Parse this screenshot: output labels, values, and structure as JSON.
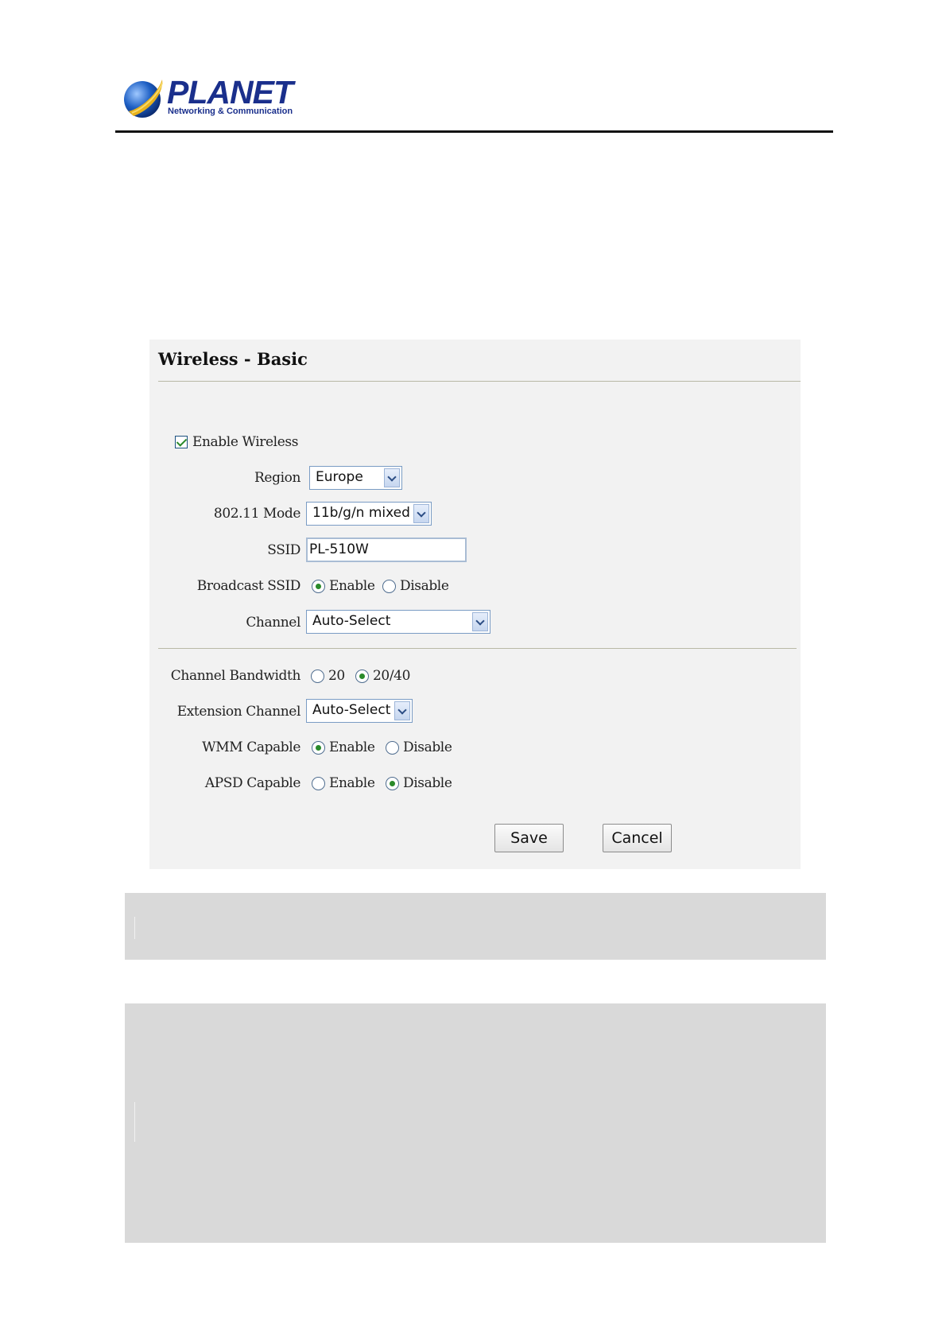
{
  "header": {
    "brand": "PLANET",
    "tagline": "Networking & Communication"
  },
  "panel": {
    "title": "Wireless - Basic",
    "enable_wireless": {
      "label": "Enable Wireless",
      "checked": true
    },
    "region": {
      "label": "Region",
      "value": "Europe"
    },
    "mode": {
      "label": "802.11 Mode",
      "value": "11b/g/n mixed"
    },
    "ssid": {
      "label": "SSID",
      "value": "PL-510W"
    },
    "broadcast_ssid": {
      "label": "Broadcast SSID",
      "options": [
        "Enable",
        "Disable"
      ],
      "selected": "Enable"
    },
    "channel": {
      "label": "Channel",
      "value": "Auto-Select"
    },
    "channel_bandwidth": {
      "label": "Channel Bandwidth",
      "options": [
        "20",
        "20/40"
      ],
      "selected": "20/40"
    },
    "extension_channel": {
      "label": "Extension Channel",
      "value": "Auto-Select"
    },
    "wmm_capable": {
      "label": "WMM Capable",
      "options": [
        "Enable",
        "Disable"
      ],
      "selected": "Enable"
    },
    "apsd_capable": {
      "label": "APSD Capable",
      "options": [
        "Enable",
        "Disable"
      ],
      "selected": "Disable"
    },
    "buttons": {
      "save": "Save",
      "cancel": "Cancel"
    }
  },
  "colors": {
    "brand_blue": "#1a2f8c",
    "panel_bg": "#f2f2f2",
    "grey_block": "#d9d9d9",
    "check_green": "#2a8a2a"
  },
  "icons": [
    "planet-logo-globe-icon",
    "dropdown-arrow-icon",
    "checkbox-check-icon"
  ]
}
